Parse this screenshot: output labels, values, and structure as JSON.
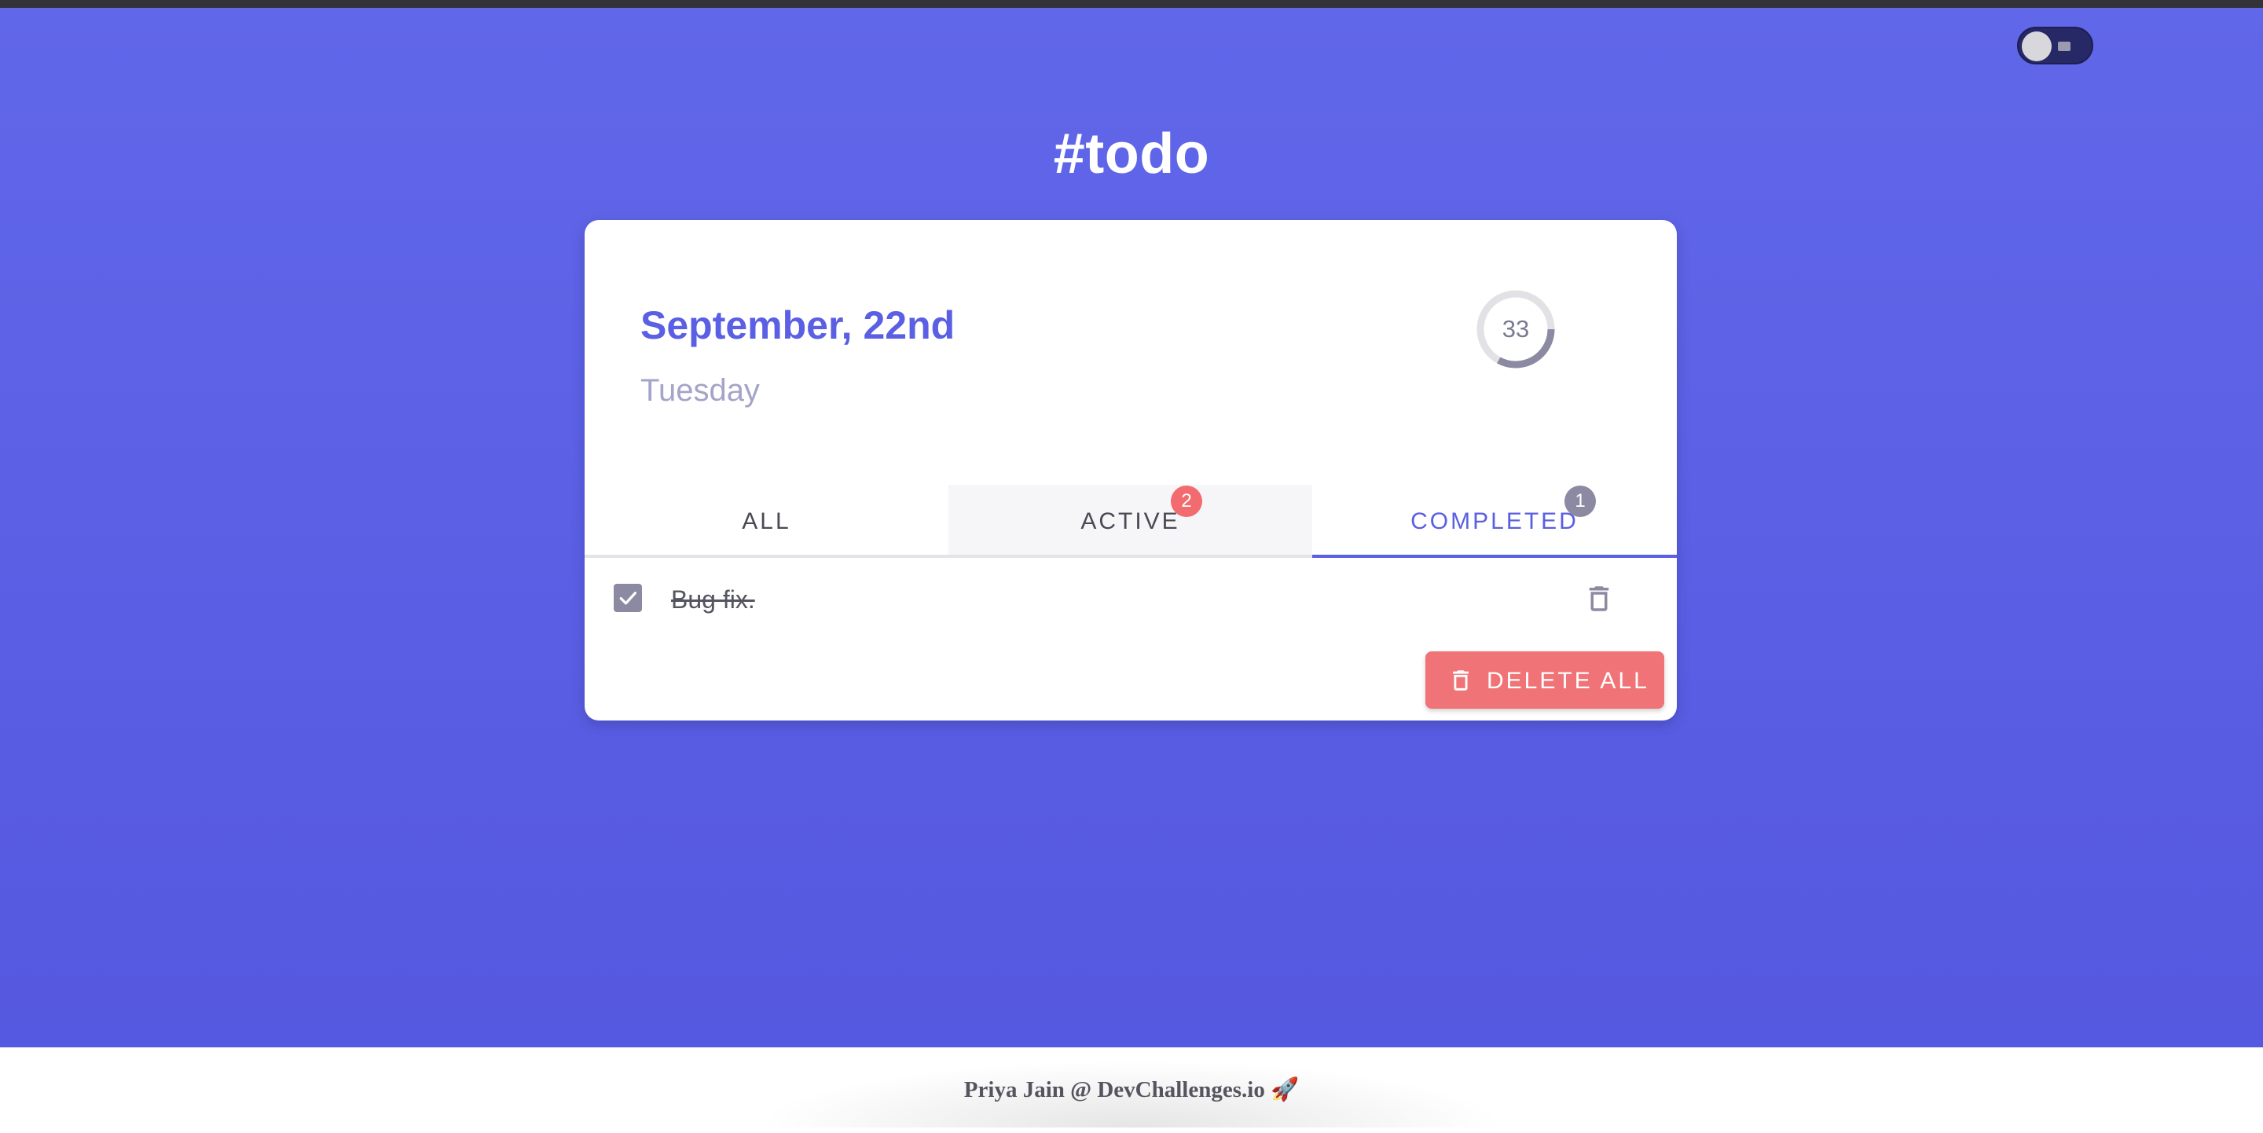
{
  "app": {
    "title": "#todo"
  },
  "theme_toggle": {
    "state": "off"
  },
  "date_header": {
    "date": "September, 22nd",
    "weekday": "Tuesday"
  },
  "progress": {
    "value": "33",
    "fraction": 0.33
  },
  "tabs": [
    {
      "label": "ALL"
    },
    {
      "label": "ACTIVE",
      "badge": "2"
    },
    {
      "label": "COMPLETED",
      "badge": "1"
    }
  ],
  "selected_tab": "COMPLETED",
  "todos": [
    {
      "text": "Bug fix.",
      "completed": true
    }
  ],
  "actions": {
    "delete_all_label": "DELETE ALL"
  },
  "footer": {
    "credit": "Priya Jain @ DevChallenges.io 🚀"
  },
  "colors": {
    "accent": "#5a5fe3",
    "background": "#6167e9",
    "danger": "#f07477",
    "muted": "#8c8aa2"
  },
  "icons": [
    "toggle-icon",
    "checkbox-checked-icon",
    "trash-icon"
  ]
}
